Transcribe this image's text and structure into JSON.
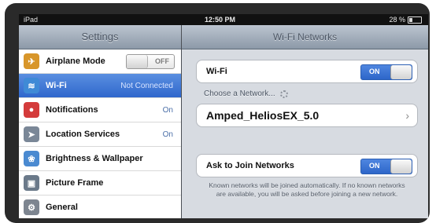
{
  "status_bar": {
    "carrier": "iPad",
    "time": "12:50 PM",
    "battery": "28 %",
    "battery_level": 0.28
  },
  "sidebar": {
    "title": "Settings",
    "items": [
      {
        "label": "Airplane Mode",
        "value": "OFF",
        "icon": "airplane-icon",
        "color": "#d8962a"
      },
      {
        "label": "Wi-Fi",
        "value": "Not Connected",
        "icon": "wifi-icon",
        "color": "#3f8ad6",
        "selected": true
      },
      {
        "label": "Notifications",
        "value": "On",
        "icon": "notifications-icon",
        "color": "#d43b3b"
      },
      {
        "label": "Location Services",
        "value": "On",
        "icon": "location-icon",
        "color": "#7a8797"
      },
      {
        "label": "Brightness & Wallpaper",
        "value": "",
        "icon": "brightness-icon",
        "color": "#4a8ad1"
      },
      {
        "label": "Picture Frame",
        "value": "",
        "icon": "picture-frame-icon",
        "color": "#6b7a8a"
      },
      {
        "label": "General",
        "value": "",
        "icon": "gear-icon",
        "color": "#7d8590"
      }
    ]
  },
  "detail": {
    "title": "Wi-Fi Networks",
    "wifi": {
      "label": "Wi-Fi",
      "state": "ON"
    },
    "choose_label": "Choose a Network...",
    "network": "Amped_HeliosEX_5.0",
    "ask": {
      "label": "Ask to Join Networks",
      "state": "ON"
    },
    "footnote": "Known networks will be joined automatically. If no known networks are available, you will be asked before joining a new network."
  },
  "colors": {
    "accent": "#2d66c9",
    "selected_row": "#3b76d6",
    "nav_bar": "#a2adba"
  }
}
